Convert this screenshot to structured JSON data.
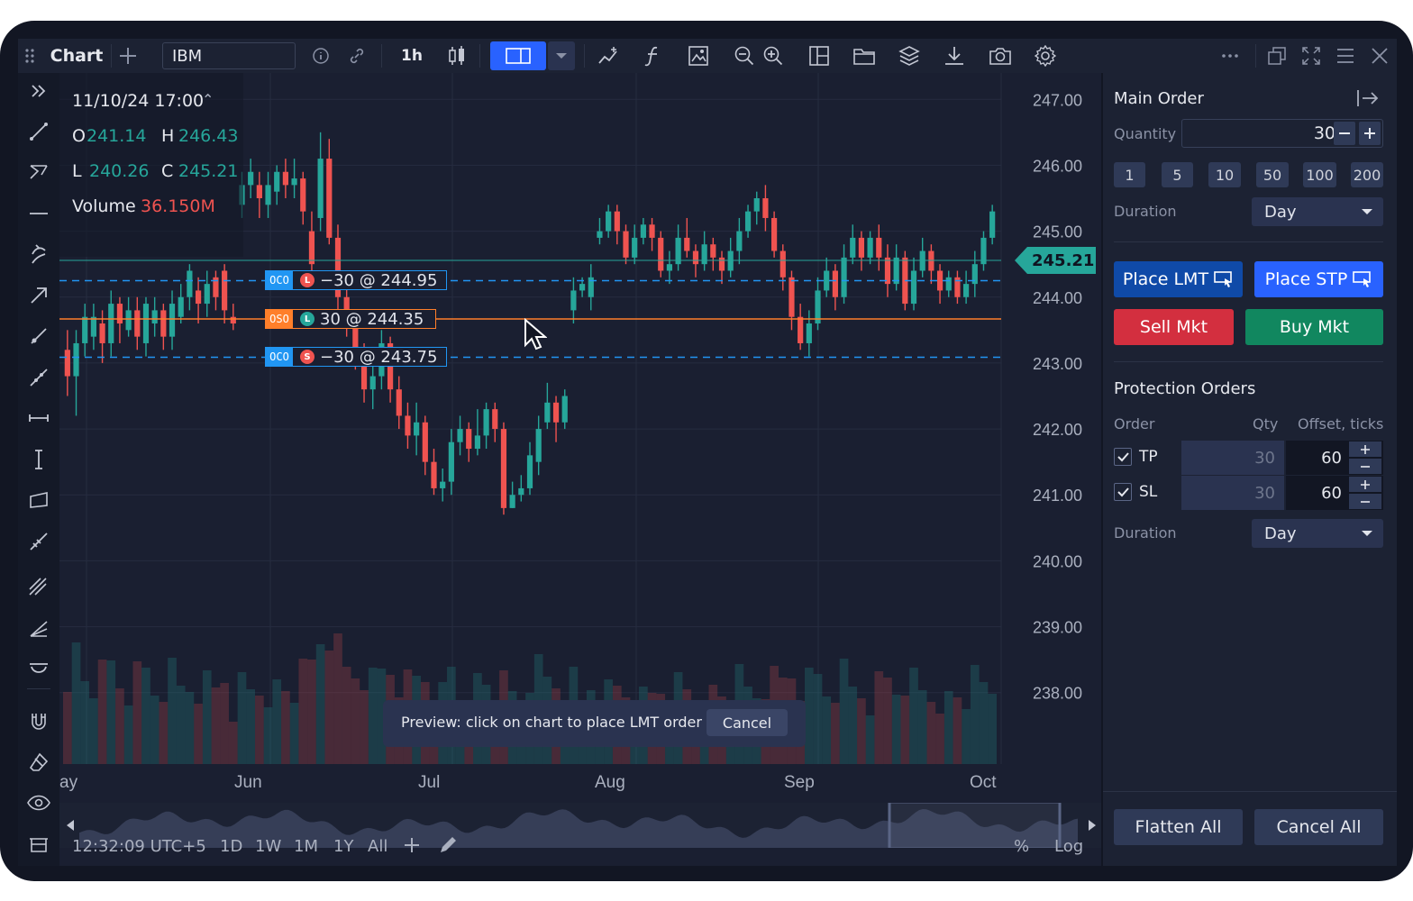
{
  "toolbar": {
    "chart_label": "Chart",
    "symbol": "IBM",
    "interval": "1h"
  },
  "legend": {
    "datetime": "11/10/24 17:00",
    "open_label": "O",
    "open": "241.14",
    "high_label": "H",
    "high": "246.43",
    "low_label": "L",
    "low": "240.26",
    "close_label": "C",
    "close": "245.21",
    "volume_label": "Volume",
    "volume": "36.150M"
  },
  "price_axis": {
    "ticks": [
      "247.00",
      "246.00",
      "245.00",
      "244.00",
      "243.00",
      "242.00",
      "241.00",
      "240.00",
      "239.00",
      "238.00"
    ],
    "current_price": "245.21"
  },
  "time_axis": {
    "ticks": [
      "ay",
      "Jun",
      "Jul",
      "Aug",
      "Sep",
      "Oct"
    ]
  },
  "orders": [
    {
      "badge": "OCO",
      "type": "L",
      "text": "−30 @ 244.95"
    },
    {
      "badge": "OSO",
      "type": "L",
      "text": "30 @ 244.35"
    },
    {
      "badge": "OCO",
      "type": "S",
      "text": "−30 @ 243.75"
    }
  ],
  "preview": {
    "message": "Preview: click on chart to place LMT order",
    "cancel": "Cancel"
  },
  "bottom_bar": {
    "time": "12:32:09 UTC+5",
    "ranges": [
      "1D",
      "1W",
      "1M",
      "1Y",
      "All"
    ],
    "percent": "%",
    "log": "Log"
  },
  "panel": {
    "main_order_title": "Main Order",
    "quantity_label": "Quantity",
    "quantity_value": "30",
    "quick_quantities": [
      "1",
      "5",
      "10",
      "50",
      "100",
      "200"
    ],
    "duration_label": "Duration",
    "duration_value": "Day",
    "place_lmt": "Place LMT",
    "place_stp": "Place STP",
    "sell_mkt": "Sell Mkt",
    "buy_mkt": "Buy Mkt",
    "protection_title": "Protection Orders",
    "col_order": "Order",
    "col_qty": "Qty",
    "col_offset": "Offset, ticks",
    "tp_label": "TP",
    "tp_qty": "30",
    "tp_offset": "60",
    "sl_label": "SL",
    "sl_qty": "30",
    "sl_offset": "60",
    "duration2_label": "Duration",
    "duration2_value": "Day",
    "flatten_all": "Flatten All",
    "cancel_all": "Cancel All"
  },
  "chart_data": {
    "type": "candlestick",
    "symbol": "IBM",
    "ylim": [
      237.6,
      247.4
    ],
    "x_ticks": [
      "Jun",
      "Jul",
      "Aug",
      "Sep",
      "Oct"
    ],
    "candles": [
      [
        243.2,
        242.8,
        243.5,
        242.5
      ],
      [
        242.8,
        243.3,
        243.5,
        242.2
      ],
      [
        243.3,
        243.7,
        243.9,
        243.1
      ],
      [
        243.4,
        243.7,
        243.9,
        243.2
      ],
      [
        243.6,
        243.3,
        243.8,
        243.0
      ],
      [
        243.3,
        243.9,
        244.1,
        243.1
      ],
      [
        243.9,
        243.6,
        244.0,
        243.3
      ],
      [
        243.5,
        243.8,
        244.0,
        243.4
      ],
      [
        243.8,
        243.4,
        244.0,
        243.2
      ],
      [
        243.3,
        243.9,
        244.0,
        243.1
      ],
      [
        243.6,
        243.8,
        244.0,
        243.4
      ],
      [
        243.8,
        243.4,
        243.9,
        243.2
      ],
      [
        243.4,
        243.9,
        244.1,
        243.2
      ],
      [
        243.7,
        244.0,
        244.2,
        243.6
      ],
      [
        244.0,
        244.4,
        244.5,
        243.8
      ],
      [
        244.1,
        243.9,
        244.3,
        243.6
      ],
      [
        243.9,
        244.2,
        244.4,
        243.7
      ],
      [
        244.3,
        244.0,
        244.4,
        243.8
      ],
      [
        244.4,
        243.8,
        244.5,
        243.6
      ],
      [
        243.7,
        243.6,
        243.9,
        243.5
      ],
      [
        245.4,
        245.7,
        245.9,
        245.2
      ],
      [
        245.7,
        245.9,
        246.1,
        245.5
      ],
      [
        245.7,
        245.5,
        245.9,
        245.2
      ],
      [
        245.4,
        245.7,
        245.9,
        245.2
      ],
      [
        245.6,
        245.9,
        246.0,
        245.4
      ],
      [
        245.9,
        245.7,
        246.1,
        245.5
      ],
      [
        245.7,
        245.8,
        246.1,
        245.5
      ],
      [
        245.8,
        245.3,
        245.9,
        245.1
      ],
      [
        245.0,
        244.5,
        245.3,
        244.3
      ],
      [
        245.2,
        246.1,
        246.5,
        245.0
      ],
      [
        246.1,
        244.9,
        246.4,
        244.8
      ],
      [
        244.9,
        244.0,
        245.1,
        243.8
      ],
      [
        244.0,
        243.6,
        244.3,
        243.4
      ],
      [
        243.6,
        243.1,
        243.8,
        242.9
      ],
      [
        243.1,
        242.6,
        243.3,
        242.4
      ],
      [
        242.6,
        242.8,
        243.0,
        242.3
      ],
      [
        242.8,
        243.3,
        243.5,
        242.6
      ],
      [
        243.3,
        242.6,
        243.4,
        242.4
      ],
      [
        242.6,
        242.2,
        242.8,
        242.0
      ],
      [
        242.2,
        241.9,
        242.4,
        241.7
      ],
      [
        241.9,
        242.1,
        242.4,
        241.6
      ],
      [
        242.1,
        241.5,
        242.2,
        241.3
      ],
      [
        241.5,
        241.1,
        241.7,
        241.0
      ],
      [
        241.1,
        241.2,
        241.4,
        240.9
      ],
      [
        241.2,
        241.8,
        242.0,
        241.0
      ],
      [
        241.8,
        242.0,
        242.2,
        241.6
      ],
      [
        242.0,
        241.7,
        242.1,
        241.5
      ],
      [
        241.7,
        241.9,
        242.3,
        241.6
      ],
      [
        241.9,
        242.3,
        242.4,
        241.7
      ],
      [
        242.3,
        242.0,
        242.4,
        241.8
      ],
      [
        242.0,
        240.8,
        242.1,
        240.7
      ],
      [
        240.8,
        241.0,
        241.2,
        240.8
      ],
      [
        241.0,
        241.1,
        241.3,
        240.9
      ],
      [
        241.1,
        241.6,
        241.8,
        241.0
      ],
      [
        241.5,
        242.0,
        242.2,
        241.3
      ],
      [
        242.1,
        242.4,
        242.7,
        242.0
      ],
      [
        242.4,
        242.1,
        242.5,
        241.8
      ],
      [
        242.1,
        242.5,
        242.6,
        242.0
      ],
      [
        243.8,
        244.1,
        244.3,
        243.6
      ],
      [
        244.1,
        244.2,
        244.3,
        244.0
      ],
      [
        244.0,
        244.3,
        244.5,
        243.8
      ],
      [
        244.9,
        245.0,
        245.2,
        244.8
      ],
      [
        245.0,
        245.3,
        245.4,
        244.9
      ],
      [
        245.3,
        245.0,
        245.4,
        244.8
      ],
      [
        245.0,
        244.6,
        245.1,
        244.5
      ],
      [
        244.6,
        244.9,
        245.1,
        244.5
      ],
      [
        244.9,
        245.1,
        245.2,
        244.8
      ],
      [
        245.1,
        244.9,
        245.2,
        244.7
      ],
      [
        244.9,
        244.4,
        245.0,
        244.3
      ],
      [
        244.4,
        244.5,
        244.7,
        244.2
      ],
      [
        244.5,
        244.9,
        245.1,
        244.4
      ],
      [
        244.9,
        244.7,
        245.2,
        244.6
      ],
      [
        244.7,
        244.5,
        244.8,
        244.3
      ],
      [
        244.5,
        244.8,
        245.0,
        244.4
      ],
      [
        244.8,
        244.6,
        244.9,
        244.4
      ],
      [
        244.6,
        244.4,
        244.7,
        244.2
      ],
      [
        244.4,
        244.7,
        244.9,
        244.3
      ],
      [
        244.7,
        245.0,
        245.2,
        244.5
      ],
      [
        245.0,
        245.3,
        245.4,
        244.9
      ],
      [
        245.3,
        245.5,
        245.6,
        245.1
      ],
      [
        245.5,
        245.2,
        245.7,
        245.0
      ],
      [
        245.2,
        244.7,
        245.3,
        244.6
      ],
      [
        244.7,
        244.3,
        244.8,
        244.1
      ],
      [
        244.3,
        243.7,
        244.4,
        243.5
      ],
      [
        243.7,
        243.3,
        243.9,
        243.2
      ],
      [
        243.3,
        243.6,
        243.8,
        243.1
      ],
      [
        243.6,
        244.1,
        244.3,
        243.5
      ],
      [
        244.1,
        244.4,
        244.6,
        244.0
      ],
      [
        244.4,
        244.0,
        244.5,
        243.8
      ],
      [
        244.0,
        244.6,
        244.8,
        243.9
      ],
      [
        244.6,
        244.9,
        245.1,
        244.5
      ],
      [
        244.9,
        244.6,
        245.0,
        244.4
      ],
      [
        244.6,
        244.9,
        245.0,
        244.5
      ],
      [
        244.9,
        244.6,
        245.1,
        244.4
      ],
      [
        244.6,
        244.2,
        244.8,
        244.0
      ],
      [
        244.2,
        244.6,
        244.8,
        244.1
      ],
      [
        244.6,
        243.9,
        244.7,
        243.8
      ],
      [
        243.9,
        244.4,
        244.6,
        243.8
      ],
      [
        244.4,
        244.7,
        244.9,
        244.3
      ],
      [
        244.7,
        244.4,
        244.8,
        244.2
      ],
      [
        244.4,
        244.1,
        244.5,
        243.9
      ],
      [
        244.1,
        244.3,
        244.4,
        244.0
      ],
      [
        244.3,
        244.0,
        244.4,
        243.9
      ],
      [
        244.0,
        244.2,
        244.4,
        243.9
      ],
      [
        244.2,
        244.5,
        244.7,
        244.0
      ],
      [
        244.5,
        244.9,
        245.0,
        244.4
      ],
      [
        244.9,
        245.3,
        245.4,
        244.8
      ]
    ]
  }
}
